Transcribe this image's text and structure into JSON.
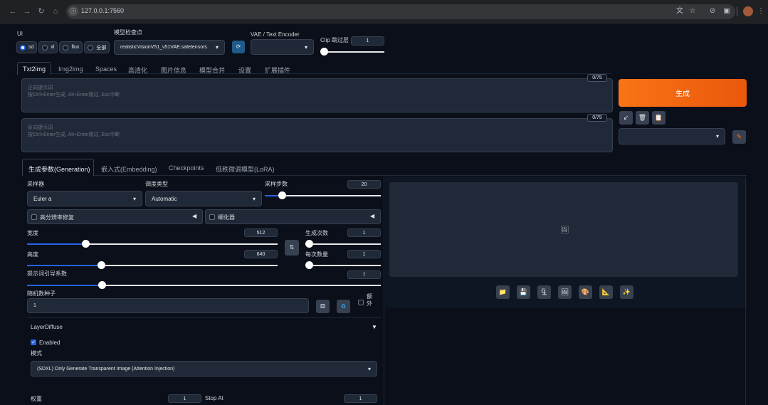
{
  "browser": {
    "url": "127.0.0.1:7560"
  },
  "top": {
    "ui_label": "UI",
    "ui_options": [
      "sd",
      "xl",
      "flux",
      "全部"
    ],
    "ui_selected": "sd",
    "checkpoint_label": "模型检查点",
    "checkpoint_value": "realisticVisionV51_v51VAE.safetensors",
    "vae_label": "VAE / Text Encoder",
    "vae_value": "",
    "clip_label": "Clip 跳过层",
    "clip_value": "1",
    "clip_level": 0
  },
  "main_tabs": [
    "Txt2img",
    "Img2img",
    "Spaces",
    "高清化",
    "图片信息",
    "模型合并",
    "设置",
    "扩展插件"
  ],
  "main_tab_active": "Txt2img",
  "prompt": {
    "label": "正向提示词",
    "hint": "按Ctrl+Enter生成, Alt+Enter跳过, Esc中断",
    "counter": "0/75"
  },
  "negative": {
    "label": "反向提示词",
    "hint": "按Ctrl+Enter生成, Alt+Enter跳过, Esc中断",
    "counter": "0/75"
  },
  "generate_label": "生成",
  "style_value": "",
  "sub_tabs": [
    "生成参数(Generation)",
    "嵌入式(Embedding)",
    "Checkpoints",
    "低秩微调模型(LoRA)"
  ],
  "sub_tab_active": "生成参数(Generation)",
  "params": {
    "sampler_label": "采样器",
    "sampler_value": "Euler a",
    "scheduler_label": "调度类型",
    "scheduler_value": "Automatic",
    "steps_label": "采样步数",
    "steps_value": "20",
    "steps_level": 0.17,
    "hires_label": "高分辨率修复",
    "refiner_label": "细化器",
    "width_label": "宽度",
    "width_value": "512",
    "width_level": 0.22,
    "height_label": "高度",
    "height_value": "640",
    "height_level": 0.3,
    "batch_count_label": "生成次数",
    "batch_count_value": "1",
    "batch_count_level": 0,
    "batch_size_label": "每次数量",
    "batch_size_value": "1",
    "batch_size_level": 0,
    "cfg_label": "提示词引导系数",
    "cfg_value": "7",
    "cfg_level": 0.2,
    "seed_label": "随机数种子",
    "seed_value": "1",
    "extra_label": "额外"
  },
  "layerdiffuse": {
    "title": "LayerDiffuse",
    "enabled_label": "Enabled",
    "method_label": "模式",
    "method_value": "(SDXL) Only Generate Transparent Image (Attention Injection)",
    "weight_label": "权重",
    "weight_value": "1",
    "stop_label": "Stop At",
    "stop_value": "1"
  },
  "output_tools": [
    "folder-icon",
    "save-icon",
    "zip-icon",
    "image-icon",
    "palette-icon",
    "ruler-icon",
    "sparkle-icon"
  ]
}
